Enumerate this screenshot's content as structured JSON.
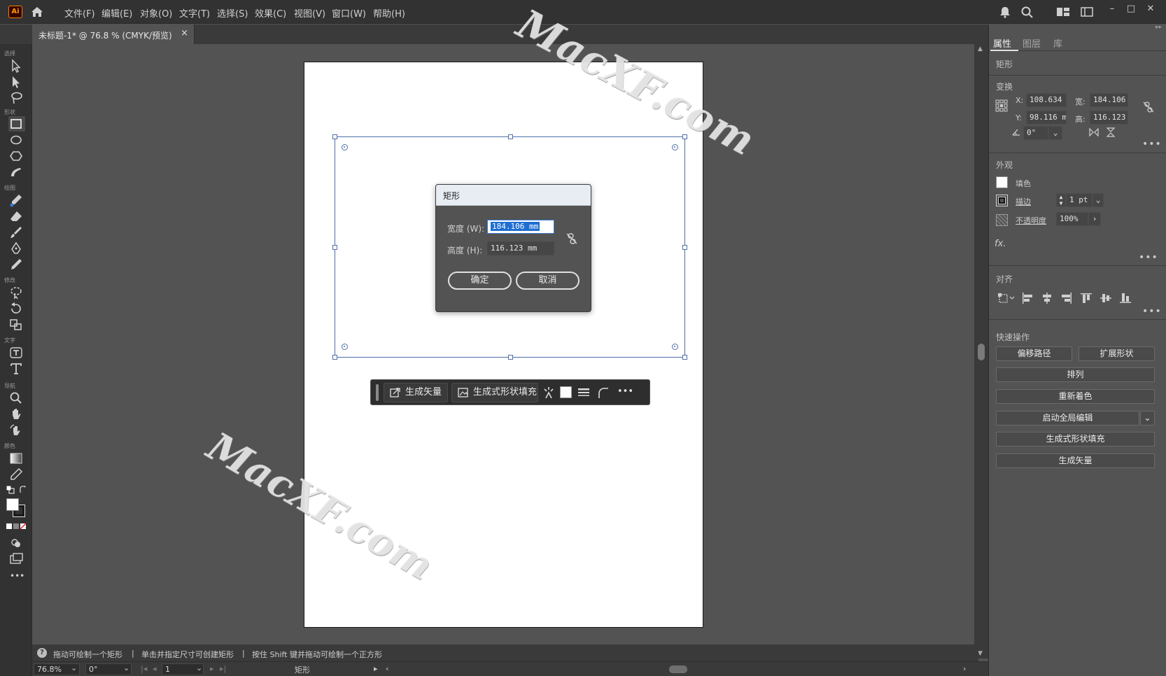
{
  "app": {
    "logo_text": "Ai",
    "menu": [
      "文件(F)",
      "编辑(E)",
      "对象(O)",
      "文字(T)",
      "选择(S)",
      "效果(C)",
      "视图(V)",
      "窗口(W)",
      "帮助(H)"
    ]
  },
  "document": {
    "tab_title": "未标题-1* @ 76.8 % (CMYK/预览)",
    "tab_close": "×"
  },
  "toolbar": {
    "groups": [
      "选择",
      "形状",
      "绘图",
      "修改",
      "文字",
      "导航",
      "颜色"
    ],
    "more": "•••"
  },
  "dialog": {
    "title": "矩形",
    "width_label": "宽度 (W):",
    "width_value": "184.106 mm",
    "height_label": "高度 (H):",
    "height_value": "116.123 mm",
    "ok_label": "确定",
    "cancel_label": "取消"
  },
  "taskbar": {
    "generate_vector": "生成矢量",
    "generate_shape_fill": "生成式形状填充",
    "more": "•••"
  },
  "watermarks": [
    "MacXF.com",
    "MacXF.com",
    "Ma"
  ],
  "status": {
    "help_icon": "?",
    "hint1": "拖动可绘制一个矩形",
    "separator": "|",
    "hint2": "单击并指定尺寸可创建矩形",
    "hint3": "按住 Shift 键并拖动可绘制一个正方形"
  },
  "bottombar": {
    "zoom": "76.8%",
    "rotation": "0°",
    "artboard_num": "1",
    "current_tool": "矩形"
  },
  "panel": {
    "tabs": [
      "属性",
      "图层",
      "库"
    ],
    "object_type": "矩形",
    "transform_title": "变换",
    "x_label": "X:",
    "x_value": "108.634",
    "y_label": "Y:",
    "y_value": "98.116 m",
    "w_label": "宽:",
    "w_value": "184.106",
    "h_label": "高:",
    "h_value": "116.123",
    "angle_value": "0°",
    "appearance_title": "外观",
    "fill_label": "填色",
    "stroke_label": "描边",
    "stroke_value": "1 pt",
    "opacity_label": "不透明度",
    "opacity_value": "100%",
    "fx_label": "fx.",
    "align_title": "对齐",
    "quick_actions_title": "快速操作",
    "qa_offset_path": "偏移路径",
    "qa_expand_shape": "扩展形状",
    "qa_arrange": "排列",
    "qa_recolor": "重新着色",
    "qa_global_edit": "启动全局编辑",
    "qa_generate_shape_fill": "生成式形状填充",
    "qa_generate_vector": "生成矢量",
    "more": "•••"
  },
  "colors": {
    "selection": "#4f6fa8",
    "highlight": "#1f6fd2",
    "logo": "#ff9a00"
  }
}
